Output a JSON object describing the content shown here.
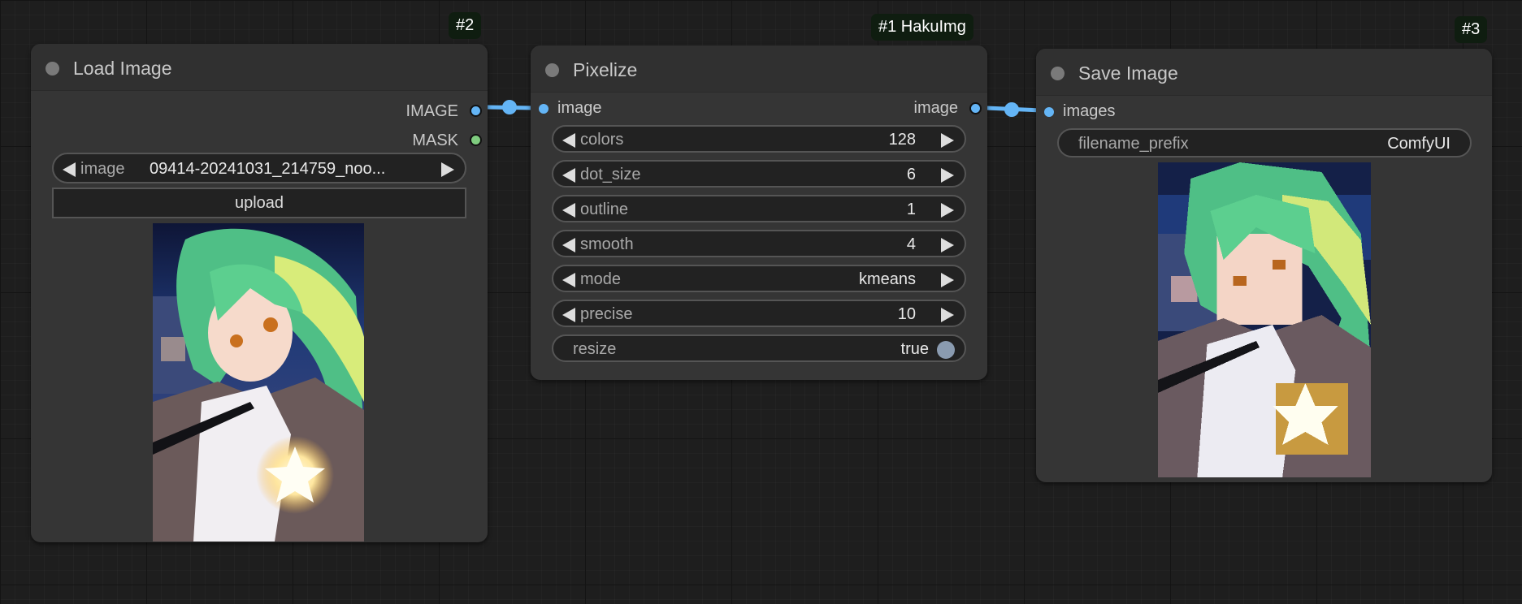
{
  "canvas": {
    "grid": true
  },
  "nodes": {
    "load_image": {
      "badge": "#2",
      "title": "Load Image",
      "outputs": [
        {
          "label": "IMAGE",
          "type": "IMAGE",
          "color": "#64b5f6"
        },
        {
          "label": "MASK",
          "type": "MASK",
          "color": "#7fcc7f"
        }
      ],
      "widgets": {
        "image_combo": {
          "label": "image",
          "value": "09414-20241031_214759_noo..."
        },
        "upload_button": {
          "label": "upload"
        }
      },
      "preview": {
        "description": "anime girl with green hair, night city background",
        "style": "original"
      }
    },
    "pixelize": {
      "badge": "#1 HakuImg",
      "title": "Pixelize",
      "inputs": [
        {
          "label": "image",
          "color": "#64b5f6"
        }
      ],
      "outputs": [
        {
          "label": "image",
          "color": "#64b5f6"
        }
      ],
      "widgets": [
        {
          "label": "colors",
          "value": "128"
        },
        {
          "label": "dot_size",
          "value": "6"
        },
        {
          "label": "outline",
          "value": "1"
        },
        {
          "label": "smooth",
          "value": "4"
        },
        {
          "label": "mode",
          "value": "kmeans"
        },
        {
          "label": "precise",
          "value": "10"
        }
      ],
      "toggle": {
        "label": "resize",
        "value": "true",
        "on": true
      }
    },
    "save_image": {
      "badge": "#3",
      "title": "Save Image",
      "inputs": [
        {
          "label": "images",
          "color": "#64b5f6"
        }
      ],
      "widgets": {
        "filename_prefix": {
          "label": "filename_prefix",
          "value": "ComfyUI"
        }
      },
      "preview": {
        "description": "pixelized anime girl with green hair",
        "style": "pixelized"
      }
    }
  },
  "links": [
    {
      "from": "load_image.IMAGE",
      "to": "pixelize.image",
      "color": "#64b5f6"
    },
    {
      "from": "pixelize.image",
      "to": "save_image.images",
      "color": "#64b5f6"
    }
  ]
}
